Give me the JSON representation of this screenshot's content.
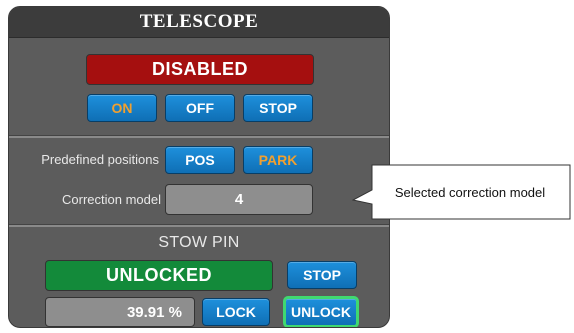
{
  "panel": {
    "title": "TELESCOPE"
  },
  "telescope": {
    "status": "DISABLED",
    "buttons": {
      "on": "ON",
      "off": "OFF",
      "stop": "STOP"
    }
  },
  "positions": {
    "predefined_label": "Predefined positions",
    "pos_button": "POS",
    "park_button": "PARK",
    "correction_label": "Correction model",
    "correction_value": "4"
  },
  "stow_pin": {
    "title": "STOW PIN",
    "status": "UNLOCKED",
    "stop_button": "STOP",
    "progress_text": "39.91 %",
    "lock_button": "LOCK",
    "unlock_button": "UNLOCK"
  },
  "callout": {
    "text": "Selected correction model"
  },
  "colors": {
    "panel_bg": "#5c5c5c",
    "button_blue": "#1e90dc",
    "highlight_orange": "#f0a030",
    "disabled_red": "#a50f0f",
    "unlocked_green": "#138a3a",
    "selected_outline": "#40d870"
  }
}
